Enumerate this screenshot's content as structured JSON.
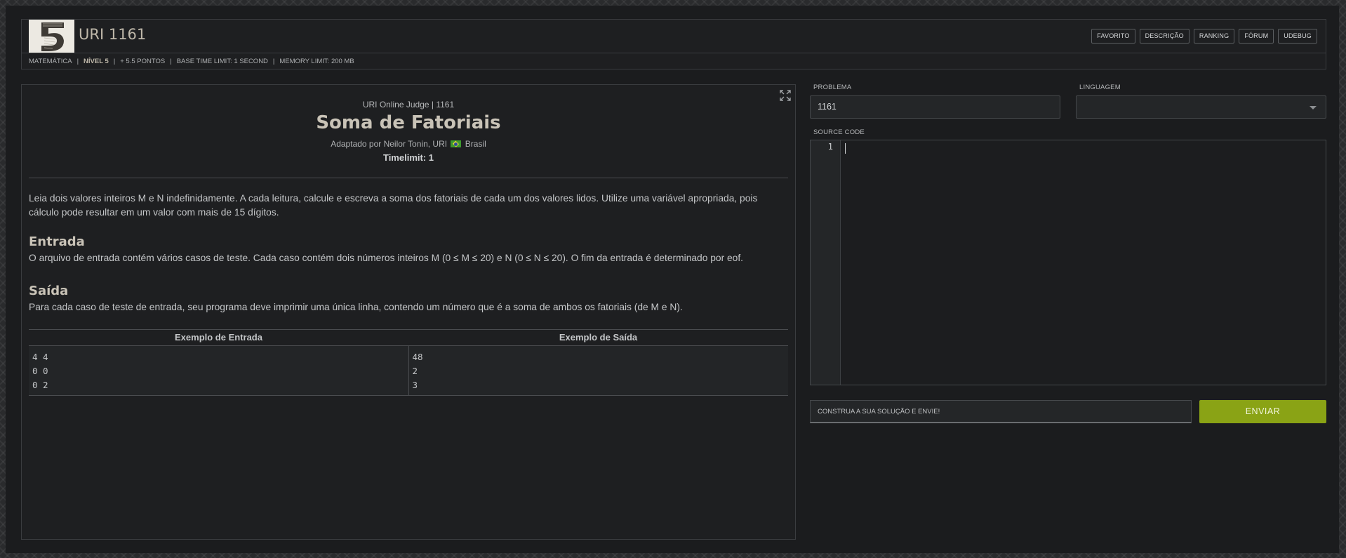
{
  "header": {
    "logo_icon": "level-5-logo",
    "title": "URI 1161",
    "buttons": [
      "FAVORITO",
      "DESCRIÇÃO",
      "RANKING",
      "FÓRUM",
      "UDEBUG"
    ],
    "meta": {
      "category": "MATEMÁTICA",
      "level": "NÍVEL 5",
      "points": "+ 5.5 PONTOS",
      "time_limit": "BASE TIME LIMIT: 1 SECOND",
      "memory_limit": "MEMORY LIMIT: 200 MB"
    }
  },
  "problem": {
    "judge_line": "URI Online Judge | 1161",
    "title": "Soma de Fatoriais",
    "adapted_prefix": "Adaptado por Neilor Tonin, URI",
    "country": "Brasil",
    "timelimit": "Timelimit: 1",
    "description": "Leia dois valores inteiros M e N indefinidamente. A cada leitura, calcule e escreva a soma dos fatoriais de cada um dos valores lidos. Utilize uma variável apropriada, pois cálculo pode resultar em um valor com mais de 15 dígitos.",
    "input_heading": "Entrada",
    "input_text": "O arquivo de entrada contém vários casos de teste. Cada caso contém dois números inteiros M (0 ≤ M ≤ 20) e N (0 ≤ N ≤ 20). O fim da entrada é determinado por eof.",
    "output_heading": "Saída",
    "output_text": "Para cada caso de teste de entrada, seu programa deve imprimir uma única linha, contendo um número que é a soma de ambos os fatoriais (de M e N).",
    "examples": {
      "input_header": "Exemplo de Entrada",
      "output_header": "Exemplo de Saída",
      "input_lines": [
        "4 4",
        "0 0",
        "0 2"
      ],
      "output_lines": [
        "48",
        "2",
        "3"
      ]
    }
  },
  "submission": {
    "problem_label": "PROBLEMA",
    "problem_value": "1161",
    "language_label": "LINGUAGEM",
    "language_value": "",
    "source_label": "SOURCE CODE",
    "line_number": "1",
    "hint": "CONSTRUA A SUA SOLUÇÃO E ENVIE!",
    "submit_label": "ENVIAR",
    "submit_color": "#8aa315"
  }
}
